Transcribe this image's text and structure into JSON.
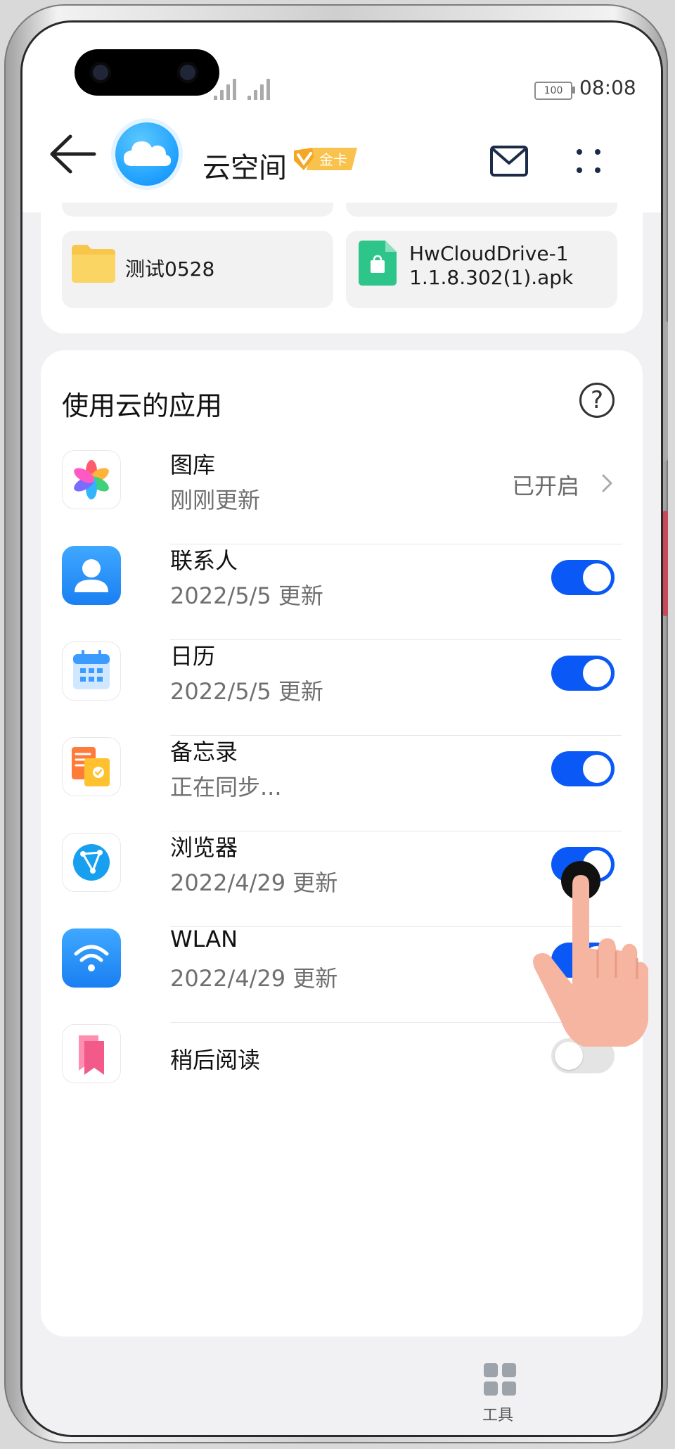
{
  "status_bar": {
    "battery": "100",
    "time": "08:08"
  },
  "header": {
    "title": "云空间",
    "badge": "金卡"
  },
  "files": [
    {
      "name": "测试0528",
      "type": "folder"
    },
    {
      "name_line1": "HwCloudDrive-1",
      "name_line2": "1.1.8.302(1).apk",
      "type": "apk"
    }
  ],
  "apps_section": {
    "title": "使用云的应用",
    "help_symbol": "?",
    "items": [
      {
        "name": "图库",
        "subtitle": "刚刚更新",
        "control": "link",
        "status": "已开启",
        "icon": "gallery-icon"
      },
      {
        "name": "联系人",
        "subtitle": "2022/5/5 更新",
        "control": "toggle",
        "on": true,
        "icon": "contacts-icon"
      },
      {
        "name": "日历",
        "subtitle": "2022/5/5 更新",
        "control": "toggle",
        "on": true,
        "icon": "calendar-icon"
      },
      {
        "name": "备忘录",
        "subtitle": "正在同步...",
        "control": "toggle",
        "on": true,
        "icon": "notes-icon"
      },
      {
        "name": "浏览器",
        "subtitle": "2022/4/29 更新",
        "control": "toggle",
        "on": true,
        "icon": "browser-icon"
      },
      {
        "name": "WLAN",
        "subtitle": "2022/4/29 更新",
        "control": "toggle",
        "on": true,
        "icon": "wlan-icon"
      },
      {
        "name": "稍后阅读",
        "subtitle": "",
        "control": "toggle",
        "on": false,
        "icon": "read-later-icon"
      }
    ]
  },
  "bottom_nav": {
    "tools_label": "工具"
  },
  "colors": {
    "accent": "#0a59f7",
    "gold": "#f5b342",
    "cloud_blue": "#1e9fff"
  }
}
